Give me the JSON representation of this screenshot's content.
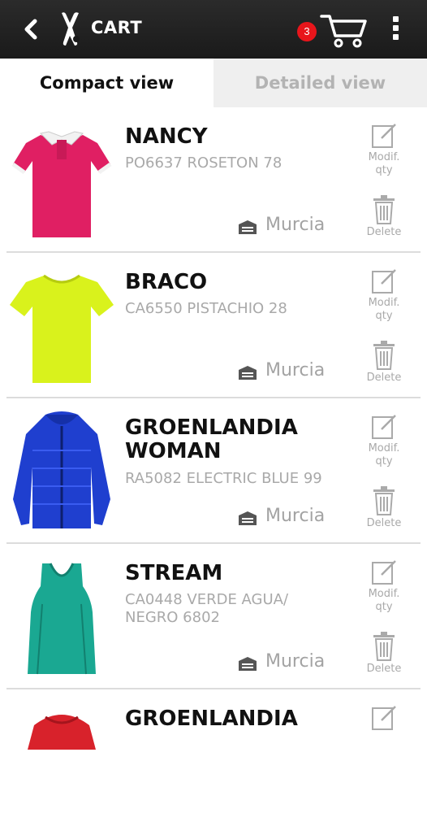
{
  "header": {
    "title": "CART",
    "cart_count": "3"
  },
  "tabs": [
    {
      "label": "Compact view",
      "active": true
    },
    {
      "label": "Detailed view",
      "active": false
    }
  ],
  "items": [
    {
      "name": "NANCY",
      "code": "PO6637 ROSETON 78",
      "store": "Murcia",
      "modify_label": "Modif. qty",
      "delete_label": "Delete",
      "color": "#e01f63",
      "garment": "polo-shirt"
    },
    {
      "name": "BRACO",
      "code": "CA6550 PISTACHIO 28",
      "store": "Murcia",
      "modify_label": "Modif. qty",
      "delete_label": "Delete",
      "color": "#d9f21c",
      "garment": "t-shirt"
    },
    {
      "name": "GROENLANDIA WOMAN",
      "code": "RA5082 ELECTRIC BLUE 99",
      "store": "Murcia",
      "modify_label": "Modif. qty",
      "delete_label": "Delete",
      "color": "#1f3fcf",
      "garment": "puffer-jacket"
    },
    {
      "name": "STREAM",
      "code": "CA0448 VERDE AGUA/ NEGRO 6802",
      "store": "Murcia",
      "modify_label": "Modif. qty",
      "delete_label": "Delete",
      "color": "#1aa892",
      "garment": "tank-top"
    },
    {
      "name": "GROENLANDIA",
      "code": "",
      "store": "",
      "modify_label": "",
      "delete_label": "",
      "color": "#d8222b",
      "garment": "jacket"
    }
  ]
}
